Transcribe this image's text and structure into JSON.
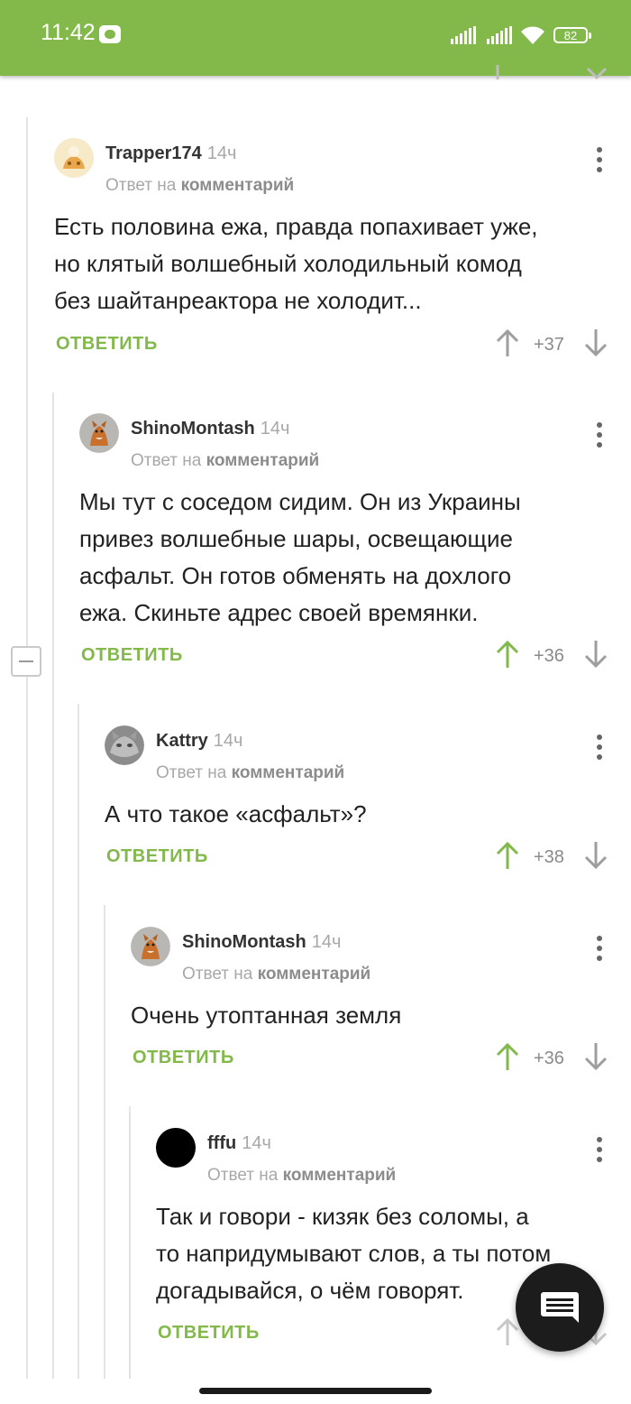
{
  "status_bar": {
    "time": "11:42",
    "battery": "82"
  },
  "comments": [
    {
      "author": "Trapper174",
      "time": "14ч",
      "reply_prefix": "Ответ на",
      "reply_link": "комментарий",
      "lines": [
        "Есть половина ежа, правда попахивает уже,",
        "но клятый волшебный холодильный комод",
        "без шайтанреактора не холодит..."
      ],
      "reply_label": "ОТВЕТИТЬ",
      "score": "+37",
      "upvoted": false
    },
    {
      "author": "ShinoMontash",
      "time": "14ч",
      "reply_prefix": "Ответ на",
      "reply_link": "комментарий",
      "lines": [
        "Мы тут с соседом сидим. Он из Украины",
        "привез волшебные шары, освещающие",
        "асфальт. Он готов обменять на дохлого",
        "ежа. Скиньте адрес своей времянки."
      ],
      "reply_label": "ОТВЕТИТЬ",
      "score": "+36",
      "upvoted": true
    },
    {
      "author": "Kattry",
      "time": "14ч",
      "reply_prefix": "Ответ на",
      "reply_link": "комментарий",
      "lines": [
        "А что такое «асфальт»?"
      ],
      "reply_label": "ОТВЕТИТЬ",
      "score": "+38",
      "upvoted": true
    },
    {
      "author": "ShinoMontash",
      "time": "14ч",
      "reply_prefix": "Ответ на",
      "reply_link": "комментарий",
      "lines": [
        "Очень утоптанная земля"
      ],
      "reply_label": "ОТВЕТИТЬ",
      "score": "+36",
      "upvoted": true
    },
    {
      "author": "fffu",
      "time": "14ч",
      "reply_prefix": "Ответ на",
      "reply_link": "комментарий",
      "lines": [
        "Так и говори - кизяк без соломы, а",
        "то напридумывают слов, а ты потом",
        "догадывайся, о чём говорят."
      ],
      "reply_label": "ОТВЕТИТЬ",
      "score": "",
      "upvoted": false
    }
  ],
  "colors": {
    "accent": "#82b94a",
    "muted": "#a8a8a8",
    "fab": "#1c1c1c"
  },
  "icons": {
    "upvote": "arrow-up-icon",
    "downvote": "arrow-down-icon",
    "more": "more-vertical-icon",
    "fab": "comment-icon",
    "collapse": "minus-icon"
  }
}
